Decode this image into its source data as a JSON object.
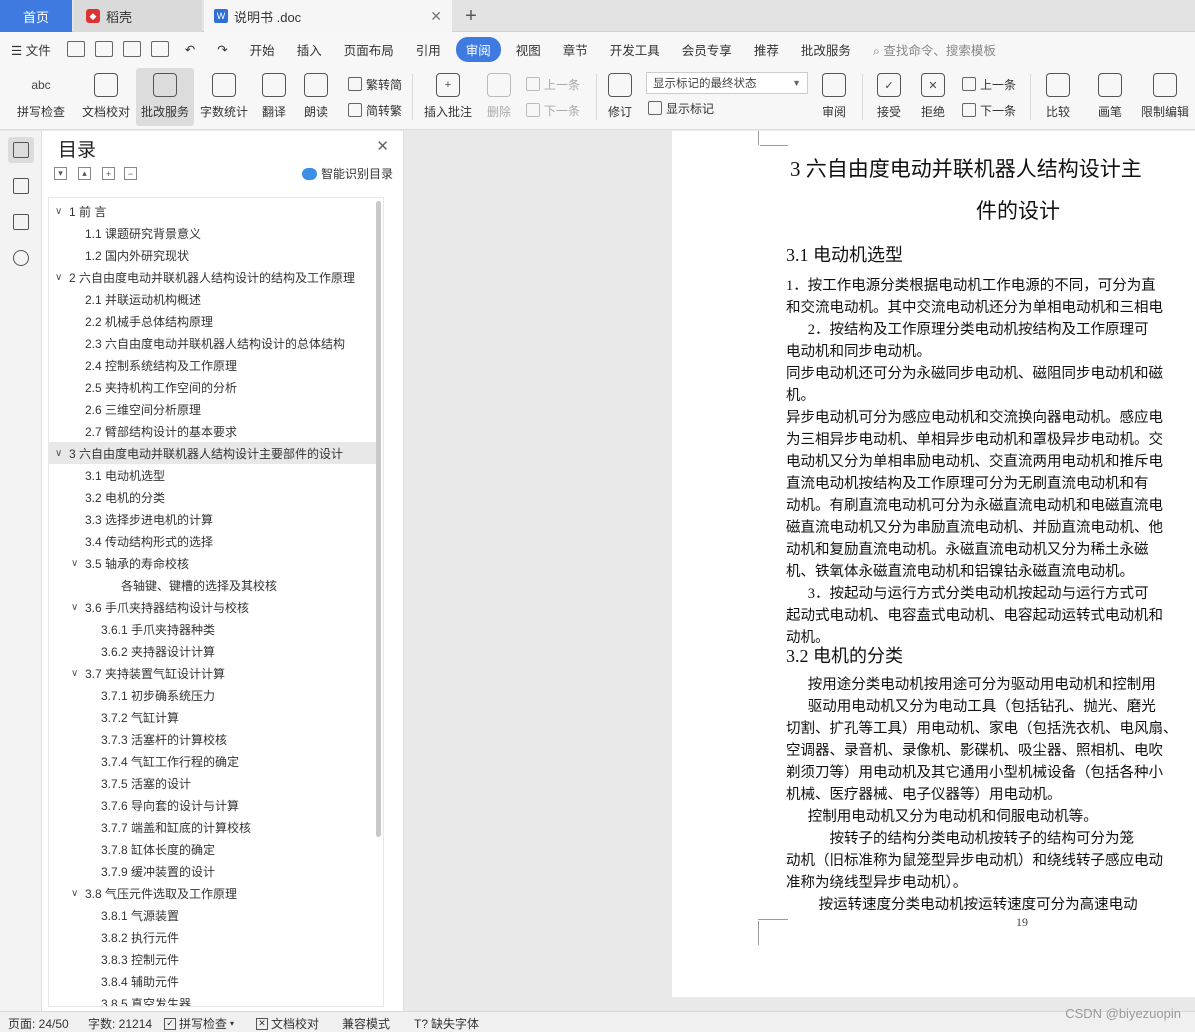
{
  "tabs": {
    "home": "首页",
    "daoke": "稻壳",
    "doc": "说明书 .doc",
    "plus": "+",
    "close": "✕"
  },
  "menu": {
    "file": "文件",
    "items": [
      "开始",
      "插入",
      "页面布局",
      "引用",
      "审阅",
      "视图",
      "章节",
      "开发工具",
      "会员专享",
      "推荐",
      "批改服务"
    ],
    "active": "审阅",
    "search": "查找命令、搜索模板"
  },
  "ribbon": {
    "spell": "拼写检查",
    "proof": "文档校对",
    "correct": "批改服务",
    "wordcount": "字数统计",
    "translate": "翻译",
    "read": "朗读",
    "trad": "繁转简",
    "simp": "简转繁",
    "insert_comment": "插入批注",
    "delete": "删除",
    "prev": "上一条",
    "next": "下一条",
    "revise": "修订",
    "markup_state": "显示标记的最终状态",
    "show_markup": "显示标记",
    "review": "审阅",
    "accept": "接受",
    "reject": "拒绝",
    "prev2": "上一条",
    "next2": "下一条",
    "compare": "比较",
    "pen": "画笔",
    "restrict": "限制编辑"
  },
  "toc": {
    "title": "目录",
    "smart": "智能识别目录",
    "items": [
      {
        "t": "1   前 言",
        "lvl": 1,
        "exp": true
      },
      {
        "t": "1.1  课题研究背景意义",
        "lvl": 2
      },
      {
        "t": "1.2  国内外研究现状",
        "lvl": 2
      },
      {
        "t": "2   六自由度电动并联机器人结构设计的结构及工作原理",
        "lvl": 1,
        "exp": true
      },
      {
        "t": "2.1  并联运动机构概述",
        "lvl": 2
      },
      {
        "t": "2.2  机械手总体结构原理",
        "lvl": 2
      },
      {
        "t": "2.3 六自由度电动并联机器人结构设计的总体结构",
        "lvl": 2
      },
      {
        "t": "2.4  控制系统结构及工作原理",
        "lvl": 2
      },
      {
        "t": "2.5  夹持机构工作空间的分析",
        "lvl": 2
      },
      {
        "t": "2.6 三维空间分析原理",
        "lvl": 2
      },
      {
        "t": "2.7  臂部结构设计的基本要求",
        "lvl": 2
      },
      {
        "t": "3   六自由度电动并联机器人结构设计主要部件的设计",
        "lvl": 1,
        "exp": true,
        "hl": true
      },
      {
        "t": "3.1  电动机选型",
        "lvl": 2
      },
      {
        "t": "3.2 电机的分类",
        "lvl": 2
      },
      {
        "t": "3.3 选择步进电机的计算",
        "lvl": 2
      },
      {
        "t": "3.4 传动结构形式的选择",
        "lvl": 2
      },
      {
        "t": "3.5  轴承的寿命校核",
        "lvl": 2,
        "exp": true
      },
      {
        "t": "各轴键、键槽的选择及其校核",
        "lvl": 4
      },
      {
        "t": "3.6  手爪夹持器结构设计与校核",
        "lvl": 2,
        "exp": true
      },
      {
        "t": "3.6.1 手爪夹持器种类",
        "lvl": 3
      },
      {
        "t": "3.6.2 夹持器设计计算",
        "lvl": 3
      },
      {
        "t": "3.7  夹持装置气缸设计计算",
        "lvl": 2,
        "exp": true
      },
      {
        "t": "3.7.1  初步确系统压力",
        "lvl": 3
      },
      {
        "t": "3.7.2 气缸计算",
        "lvl": 3
      },
      {
        "t": "3.7.3  活塞杆的计算校核",
        "lvl": 3
      },
      {
        "t": "3.7.4  气缸工作行程的确定",
        "lvl": 3
      },
      {
        "t": "3.7.5  活塞的设计",
        "lvl": 3
      },
      {
        "t": "3.7.6  导向套的设计与计算",
        "lvl": 3
      },
      {
        "t": "3.7.7  端盖和缸底的计算校核",
        "lvl": 3
      },
      {
        "t": "3.7.8  缸体长度的确定",
        "lvl": 3
      },
      {
        "t": "3.7.9  缓冲装置的设计",
        "lvl": 3
      },
      {
        "t": "3.8  气压元件选取及工作原理",
        "lvl": 2,
        "exp": true
      },
      {
        "t": "3.8.1  气源装置",
        "lvl": 3
      },
      {
        "t": "3.8.2  执行元件",
        "lvl": 3
      },
      {
        "t": "3.8.3  控制元件",
        "lvl": 3
      },
      {
        "t": "3.8.4  辅助元件",
        "lvl": 3
      },
      {
        "t": "3.8.5  真空发生器",
        "lvl": 3
      }
    ]
  },
  "doc": {
    "h1a": "3    六自由度电动并联机器人结构设计主",
    "h1b": "件的设计",
    "h2a": "3.1  电动机选型",
    "lines1": [
      "1．按工作电源分类根据电动机工作电源的不同，可分为直",
      "和交流电动机。其中交流电动机还分为单相电动机和三相电",
      "      2．按结构及工作原理分类电动机按结构及工作原理可",
      "电动机和同步电动机。",
      "同步电动机还可分为永磁同步电动机、磁阻同步电动机和磁",
      "机。",
      "异步电动机可分为感应电动机和交流换向器电动机。感应电",
      "为三相异步电动机、单相异步电动机和罩极异步电动机。交",
      "电动机又分为单相串励电动机、交直流两用电动机和推斥电",
      "直流电动机按结构及工作原理可分为无刷直流电动机和有",
      "动机。有刷直流电动机可分为永磁直流电动机和电磁直流电",
      "磁直流电动机又分为串励直流电动机、并励直流电动机、他",
      "动机和复励直流电动机。永磁直流电动机又分为稀土永磁",
      "机、铁氧体永磁直流电动机和铝镍钴永磁直流电动机。",
      "      3．按起动与运行方式分类电动机按起动与运行方式可",
      "起动式电动机、电容盍式电动机、电容起动运转式电动机和",
      "动机。"
    ],
    "h2b": "3.2 电机的分类",
    "lines2": [
      "      按用途分类电动机按用途可分为驱动用电动机和控制用",
      "      驱动用电动机又分为电动工具（包括钻孔、抛光、磨光",
      "切割、扩孔等工具）用电动机、家电（包括洗衣机、电风扇、",
      "空调器、录音机、录像机、影碟机、吸尘器、照相机、电吹",
      "剃须刀等）用电动机及其它通用小型机械设备（包括各种小",
      "机械、医疗器械、电子仪器等）用电动机。",
      "      控制用电动机又分为电动机和伺服电动机等。",
      "            按转子的结构分类电动机按转子的结构可分为笼",
      "动机（旧标准称为鼠笼型异步电动机）和绕线转子感应电动",
      "准称为绕线型异步电动机）。",
      "         按运转速度分类电动机按运转速度可分为高速电动"
    ],
    "page_num": "19"
  },
  "status": {
    "page": "页面: 24/50",
    "words": "字数: 21214",
    "spell": "拼写检查",
    "proof": "文档校对",
    "compat": "兼容模式",
    "font": "缺失字体"
  },
  "watermark": "CSDN @biyezuopin"
}
